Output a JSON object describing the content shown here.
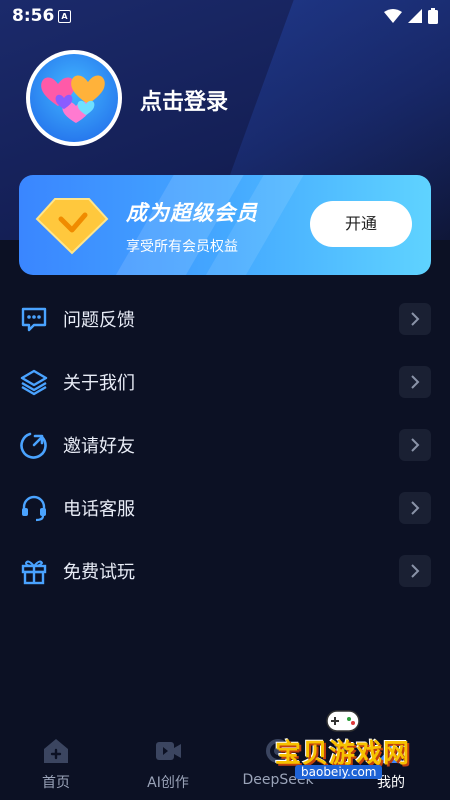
{
  "status_bar": {
    "time": "8:56",
    "notif_glyph": "A"
  },
  "profile": {
    "login_label": "点击登录"
  },
  "vip": {
    "title": "成为超级会员",
    "subtitle": "享受所有会员权益",
    "button_label": "开通"
  },
  "menu": [
    {
      "label": "问题反馈",
      "icon": "feedback-icon"
    },
    {
      "label": "关于我们",
      "icon": "layers-icon"
    },
    {
      "label": "邀请好友",
      "icon": "invite-icon"
    },
    {
      "label": "电话客服",
      "icon": "headset-icon"
    },
    {
      "label": "免费试玩",
      "icon": "gift-icon"
    }
  ],
  "tabs": [
    {
      "label": "首页",
      "icon": "home-icon"
    },
    {
      "label": "AI创作",
      "icon": "video-icon"
    },
    {
      "label": "DeepSeek",
      "icon": "deepseek-icon"
    },
    {
      "label": "我的",
      "icon": "profile-icon",
      "active": true
    }
  ],
  "watermark": {
    "text": "宝贝游戏网",
    "url": "baobeiy.com"
  },
  "colors": {
    "accent": "#3a86ff",
    "icon": "#4aa3ff",
    "background": "#0c1124"
  }
}
